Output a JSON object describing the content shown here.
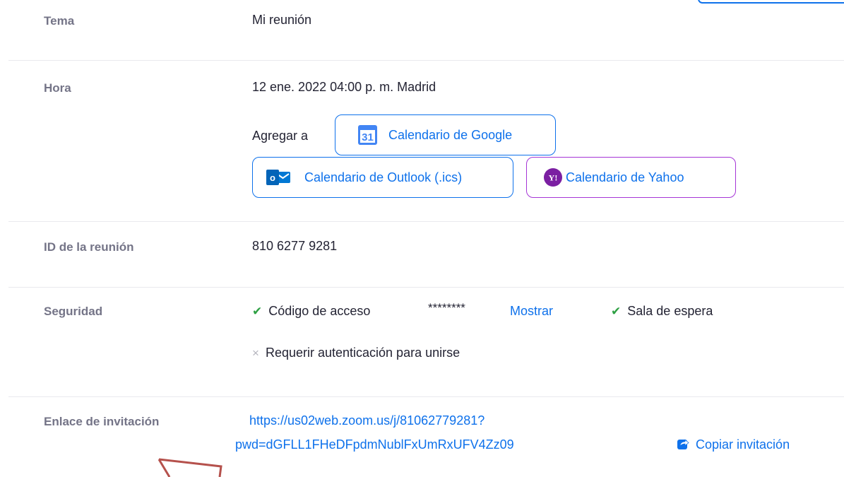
{
  "rows": {
    "topic": {
      "label": "Tema",
      "value": "Mi reunión"
    },
    "time": {
      "label": "Hora",
      "value": "12 ene. 2022 04:00 p. m. Madrid",
      "add_to_label": "Agregar a",
      "google_label": "Calendario de Google",
      "google_icon_text": "31",
      "outlook_label": "Calendario de Outlook (.ics)",
      "outlook_icon_text": "o",
      "yahoo_label": "Calendario de Yahoo",
      "yahoo_icon_text": "Y!"
    },
    "meeting_id": {
      "label": "ID de la reunión",
      "value": "810 6277 9281"
    },
    "security": {
      "label": "Seguridad",
      "passcode_label": "Código de acceso",
      "passcode_masked": "********",
      "show_label": "Mostrar",
      "waiting_room_label": "Sala de espera",
      "auth_label": "Requerir autenticación para unirse",
      "check_glyph": "✔",
      "cross_glyph": "×"
    },
    "invite": {
      "label": "Enlace de invitación",
      "url_line1": "https://us02web.zoom.us/j/81062779281?",
      "url_line2": "pwd=dGFLL1FHeDFpdmNublFxUmRxUFV4Zz09",
      "copy_label": "Copiar invitación"
    }
  },
  "colors": {
    "accent": "#0e71eb",
    "label_gray": "#747487",
    "text": "#232333",
    "yahoo_purple": "#a535d6",
    "check_green": "#2ea043",
    "annotation_red": "#b5514c"
  },
  "icons": [
    "google-calendar-icon",
    "outlook-icon",
    "yahoo-icon",
    "check-icon",
    "cross-icon",
    "share-icon"
  ]
}
